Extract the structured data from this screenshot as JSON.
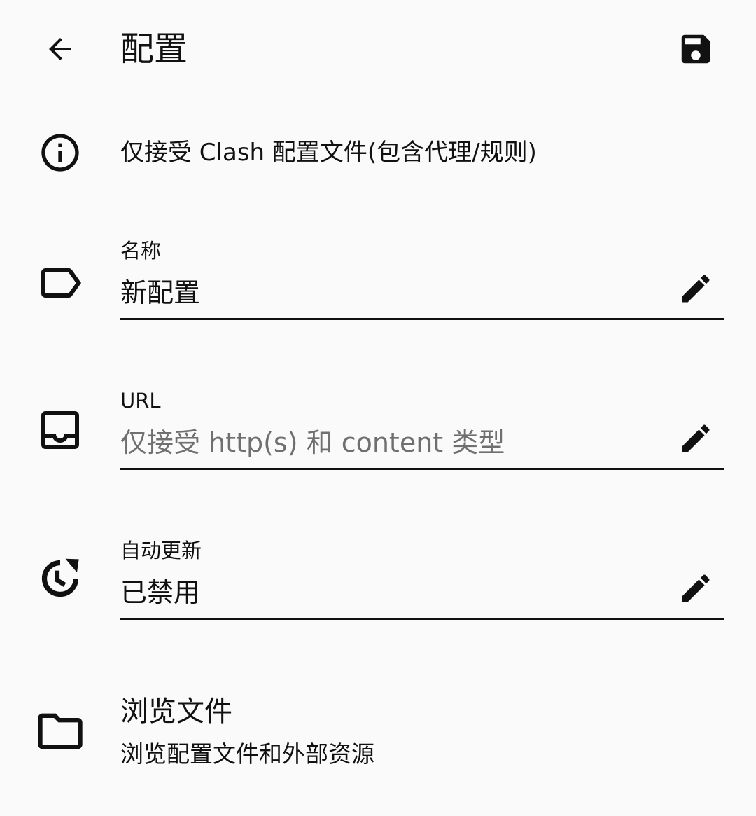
{
  "app_bar": {
    "back_icon": "arrow-back-icon",
    "title": "配置",
    "save_icon": "save-icon"
  },
  "info": {
    "icon": "info-icon",
    "text": "仅接受 Clash 配置文件(包含代理/规则)"
  },
  "fields": [
    {
      "icon": "label-tag-icon",
      "label": "名称",
      "value": "新配置",
      "placeholder": "",
      "edit_icon": "edit-pencil-icon"
    },
    {
      "icon": "inbox-tray-icon",
      "label": "URL",
      "value": "",
      "placeholder": "仅接受 http(s) 和 content 类型",
      "edit_icon": "edit-pencil-icon"
    },
    {
      "icon": "auto-update-clock-icon",
      "label": "自动更新",
      "value": "已禁用",
      "placeholder": "",
      "edit_icon": "edit-pencil-icon"
    }
  ],
  "browse": {
    "icon": "folder-icon",
    "title": "浏览文件",
    "subtitle": "浏览配置文件和外部资源"
  },
  "colors": {
    "background": "#fafafa",
    "text": "#111111",
    "placeholder": "#6f6f6f"
  }
}
